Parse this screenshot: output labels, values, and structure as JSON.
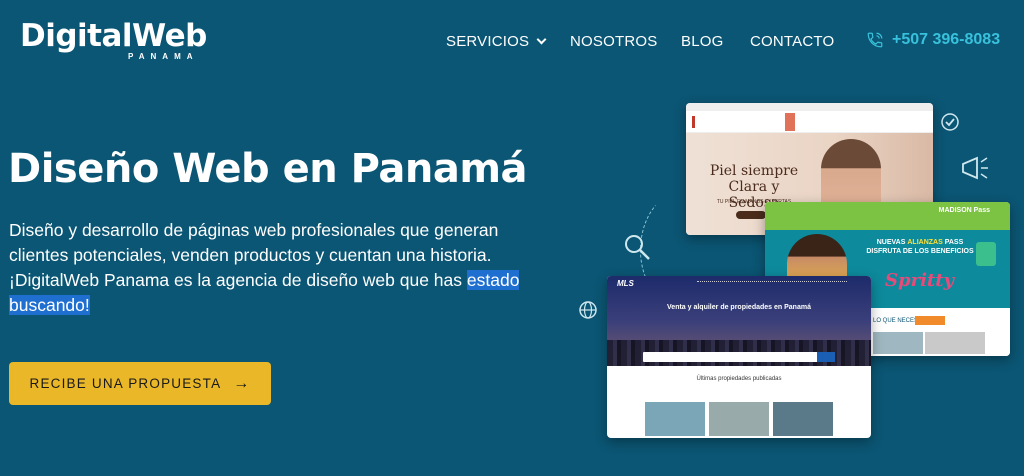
{
  "header": {
    "logo_main": "Digital",
    "logo_accent": "Web",
    "logo_sub": "PANAMA",
    "nav": [
      {
        "label": "SERVICIOS",
        "has_dropdown": true
      },
      {
        "label": "NOSOTROS"
      },
      {
        "label": "BLOG"
      },
      {
        "label": "CONTACTO"
      }
    ],
    "phone": "+507 396-8083"
  },
  "hero": {
    "title": "Diseño Web en Panamá",
    "desc_main": "Diseño y desarrollo de páginas web profesionales que generan clientes potenciales, venden productos y cuentan una historia. ¡DigitalWeb Panama es la agencia de diseño web que has ",
    "desc_highlight": "estado buscando!",
    "cta": "RECIBE UNA PROPUESTA",
    "cta_arrow": "→"
  },
  "mockups": {
    "clinic": {
      "line1": "Piel siempre",
      "line2": "Clara y Sedosa",
      "sub": "TU PIEL EN MANOS EXPERTAS"
    },
    "madison": {
      "brand": "MADISON Pass",
      "promo_pre": "NUEVAS ",
      "promo_accent": "ALIANZAS",
      "promo_post": " PASS DISFRUTA DE LOS BENEFICIOS",
      "script": "Spritty",
      "question": "LO QUE NECESITAS"
    },
    "mls": {
      "logo": "MLS",
      "title": "Venta y alquiler de propiedades en Panamá",
      "list_title": "Últimas propiedades publicadas"
    }
  },
  "colors": {
    "background": "#0b5674",
    "accent": "#e9b728",
    "phone": "#38c1dc",
    "highlight": "#1e6fd0"
  }
}
